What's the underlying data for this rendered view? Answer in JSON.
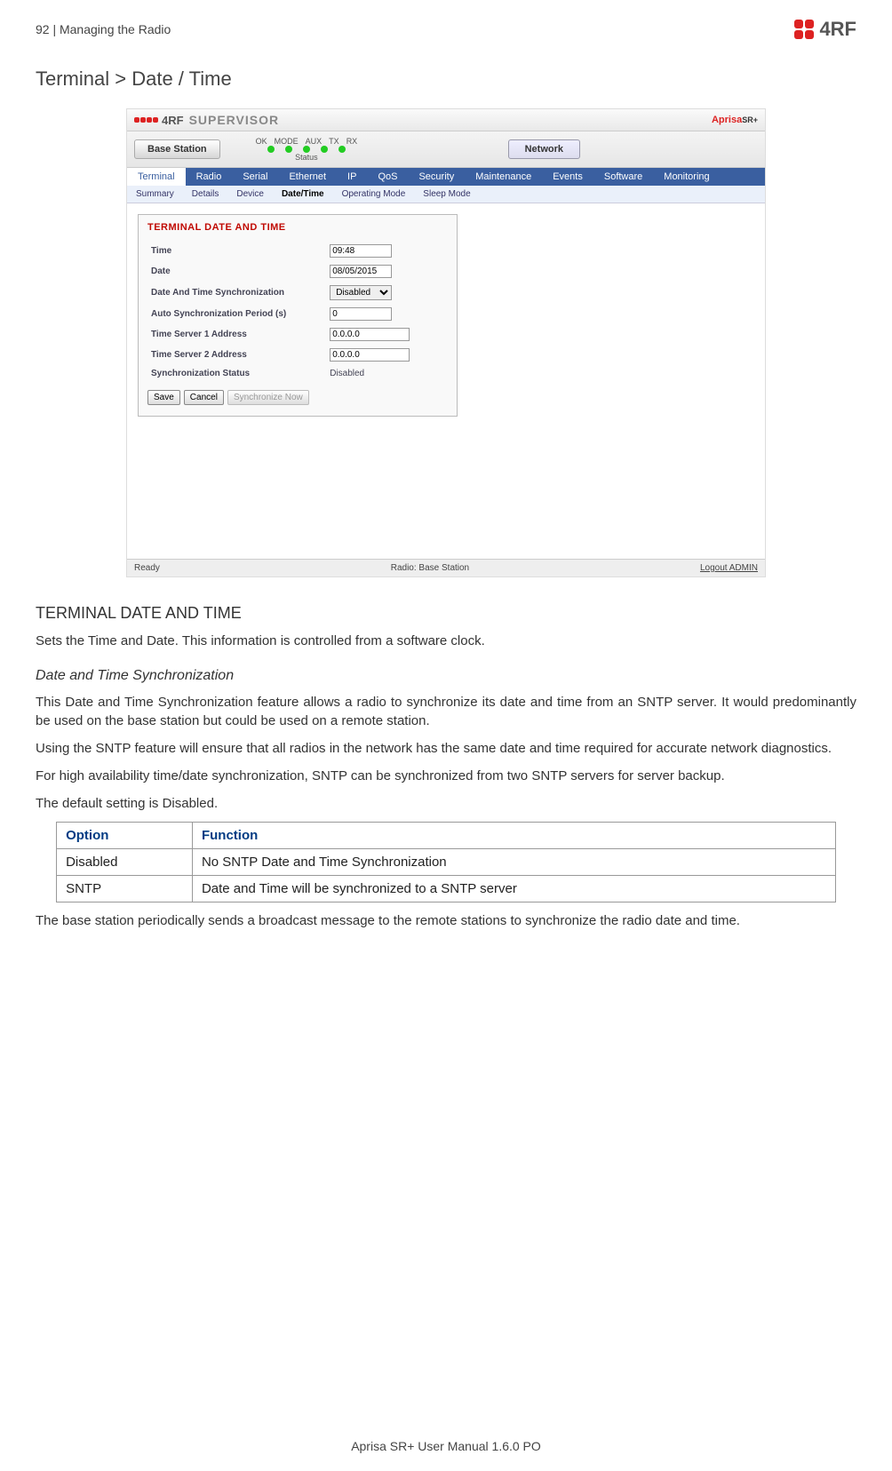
{
  "header": {
    "page_info": "92  |  Managing the Radio",
    "logo_text": "4RF"
  },
  "section_title": "Terminal > Date / Time",
  "screenshot": {
    "supervisor_label": "SUPERVISOR",
    "aprisa_logo": "Aprisa",
    "base_button": "Base Station",
    "led_names": [
      "OK",
      "MODE",
      "AUX",
      "TX",
      "RX"
    ],
    "status_label": "Status",
    "network_button": "Network",
    "mainnav": [
      "Terminal",
      "Radio",
      "Serial",
      "Ethernet",
      "IP",
      "QoS",
      "Security",
      "Maintenance",
      "Events",
      "Software",
      "Monitoring"
    ],
    "subnav": [
      "Summary",
      "Details",
      "Device",
      "Date/Time",
      "Operating Mode",
      "Sleep Mode"
    ],
    "panel_title": "TERMINAL DATE AND TIME",
    "fields": {
      "time_label": "Time",
      "time_value": "09:48",
      "date_label": "Date",
      "date_value": "08/05/2015",
      "sync_label": "Date And Time Synchronization",
      "sync_value": "Disabled",
      "period_label": "Auto Synchronization Period (s)",
      "period_value": "0",
      "srv1_label": "Time Server 1 Address",
      "srv1_value": "0.0.0.0",
      "srv2_label": "Time Server 2 Address",
      "srv2_value": "0.0.0.0",
      "status_label": "Synchronization Status",
      "status_value": "Disabled"
    },
    "buttons": {
      "save": "Save",
      "cancel": "Cancel",
      "syncnow": "Synchronize Now"
    },
    "footer": {
      "ready": "Ready",
      "radio": "Radio: Base Station",
      "logout": "Logout ADMIN"
    }
  },
  "body": {
    "h2": "TERMINAL DATE AND TIME",
    "p1": "Sets the Time and Date. This information is controlled from a software clock.",
    "h3": "Date and Time Synchronization",
    "p2": "This Date and Time Synchronization feature allows a radio to synchronize its date and time from an SNTP server. It would predominantly be used on the base station but could be used on a remote station.",
    "p3": "Using the SNTP feature will ensure that all radios in the network has the same date and time required for accurate network diagnostics.",
    "p4": "For high availability time/date synchronization, SNTP can be synchronized from two SNTP servers for server backup.",
    "p5": "The default setting is Disabled.",
    "table": {
      "th1": "Option",
      "th2": "Function",
      "r1c1": "Disabled",
      "r1c2": "No SNTP Date and Time Synchronization",
      "r2c1": "SNTP",
      "r2c2": "Date and Time will be synchronized to a SNTP server"
    },
    "p6": "The base station periodically sends a broadcast message to the remote stations to synchronize the radio date and time."
  },
  "footer_text": "Aprisa SR+ User Manual 1.6.0 PO"
}
